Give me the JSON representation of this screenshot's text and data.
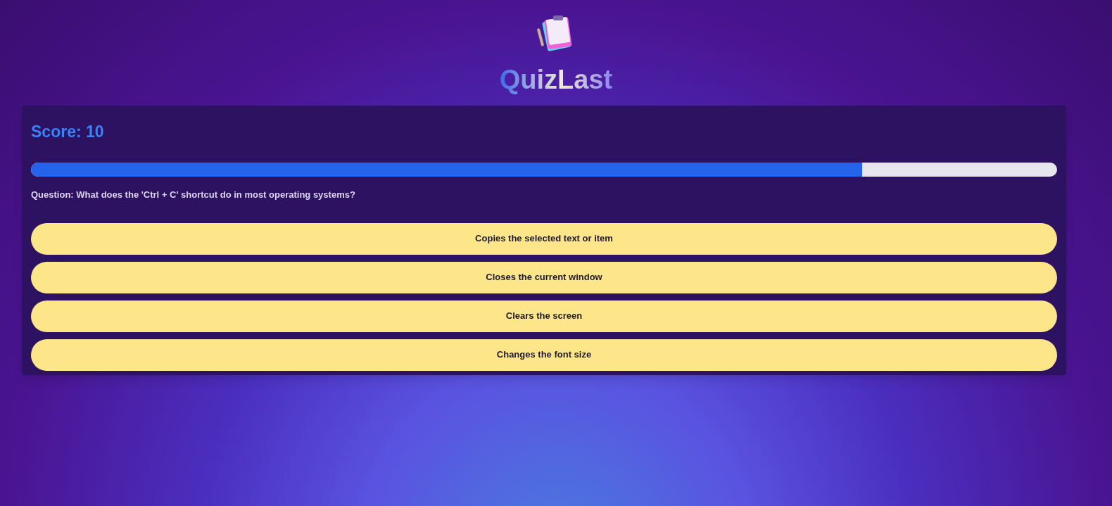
{
  "app": {
    "title": "QuizLast"
  },
  "quiz": {
    "score": "Score: 10",
    "progress": {
      "level": 0.81
    },
    "question": "Question: What does the 'Ctrl + C' shortcut do in most operating systems?",
    "answers": [
      {
        "label": "Copies the selected text or item"
      },
      {
        "label": "Closes the current window"
      },
      {
        "label": "Clears the screen"
      },
      {
        "label": "Changes the font size"
      }
    ]
  }
}
